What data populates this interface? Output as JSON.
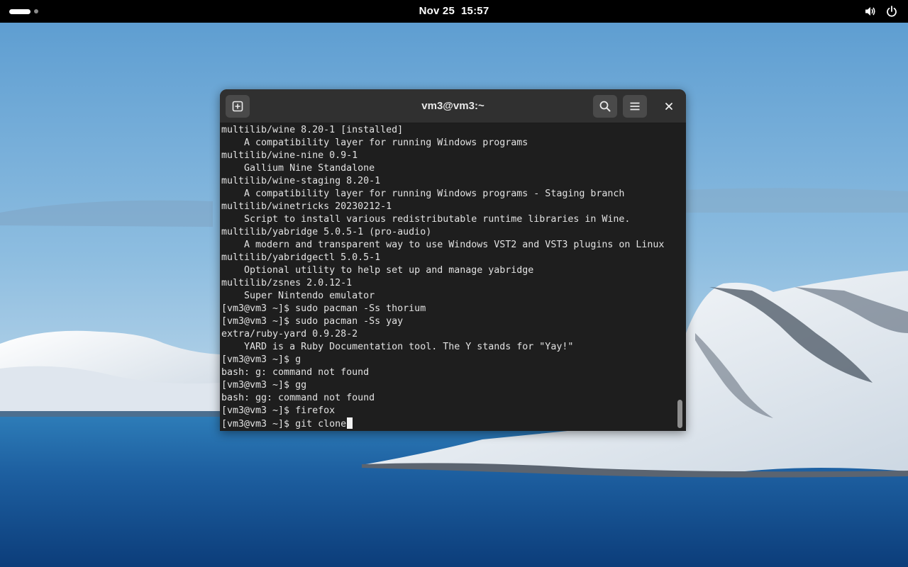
{
  "topbar": {
    "date": "Nov 25",
    "time": "15:57",
    "icons": [
      "activities-indicator",
      "volume-icon",
      "power-icon"
    ]
  },
  "window": {
    "title": "vm3@vm3:~",
    "buttons": [
      "new-tab-icon",
      "search-icon",
      "hamburger-menu-icon",
      "close-icon"
    ]
  },
  "terminal": {
    "lines": [
      "multilib/wine 8.20-1 [installed]",
      "    A compatibility layer for running Windows programs",
      "multilib/wine-nine 0.9-1",
      "    Gallium Nine Standalone",
      "multilib/wine-staging 8.20-1",
      "    A compatibility layer for running Windows programs - Staging branch",
      "multilib/winetricks 20230212-1",
      "    Script to install various redistributable runtime libraries in Wine.",
      "multilib/yabridge 5.0.5-1 (pro-audio)",
      "    A modern and transparent way to use Windows VST2 and VST3 plugins on Linux",
      "multilib/yabridgectl 5.0.5-1",
      "    Optional utility to help set up and manage yabridge",
      "multilib/zsnes 2.0.12-1",
      "    Super Nintendo emulator",
      "[vm3@vm3 ~]$ sudo pacman -Ss thorium",
      "[vm3@vm3 ~]$ sudo pacman -Ss yay",
      "extra/ruby-yard 0.9.28-2",
      "    YARD is a Ruby Documentation tool. The Y stands for \"Yay!\"",
      "[vm3@vm3 ~]$ g",
      "bash: g: command not found",
      "[vm3@vm3 ~]$ gg",
      "bash: gg: command not found",
      "[vm3@vm3 ~]$ firefox"
    ],
    "prompt_line": "[vm3@vm3 ~]$ git clone"
  },
  "colors": {
    "topbar_bg": "#000000",
    "terminal_bg": "#1e1e1e",
    "headerbar_bg": "#303030",
    "terminal_fg": "#e2e2e2"
  }
}
